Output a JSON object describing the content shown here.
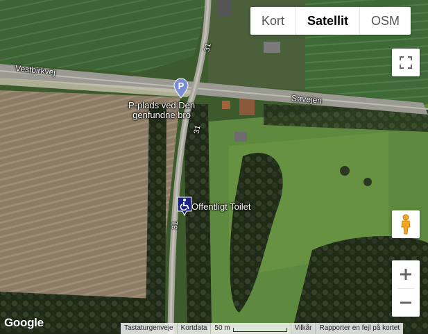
{
  "map": {
    "type_buttons": [
      {
        "label": "Kort",
        "active": false
      },
      {
        "label": "Satellit",
        "active": true
      },
      {
        "label": "OSM",
        "active": false
      }
    ],
    "controls": {
      "fullscreen_icon": "fullscreen-icon",
      "pegman_icon": "pegman-icon",
      "zoom_in_label": "+",
      "zoom_out_label": "−"
    },
    "roads": [
      {
        "name": "Vestbirkvej"
      },
      {
        "name": "Søvejen"
      },
      {
        "name": "31"
      },
      {
        "name": "31"
      },
      {
        "name": "31"
      }
    ],
    "pois": [
      {
        "icon": "parking-icon",
        "glyph": "P",
        "label_line1": "P-plads ved Den",
        "label_line2": "genfundne bro",
        "color": "#7b8fd0"
      },
      {
        "icon": "wheelchair-toilet-icon",
        "label": "Offentligt Toilet",
        "color": "#1a237e"
      }
    ],
    "logo": "Google",
    "footer": {
      "shortcuts": "Tastaturgenveje",
      "map_data": "Kortdata",
      "scale": "50 m",
      "terms": "Vilkår",
      "report": "Rapporter en fejl på kortet"
    }
  }
}
